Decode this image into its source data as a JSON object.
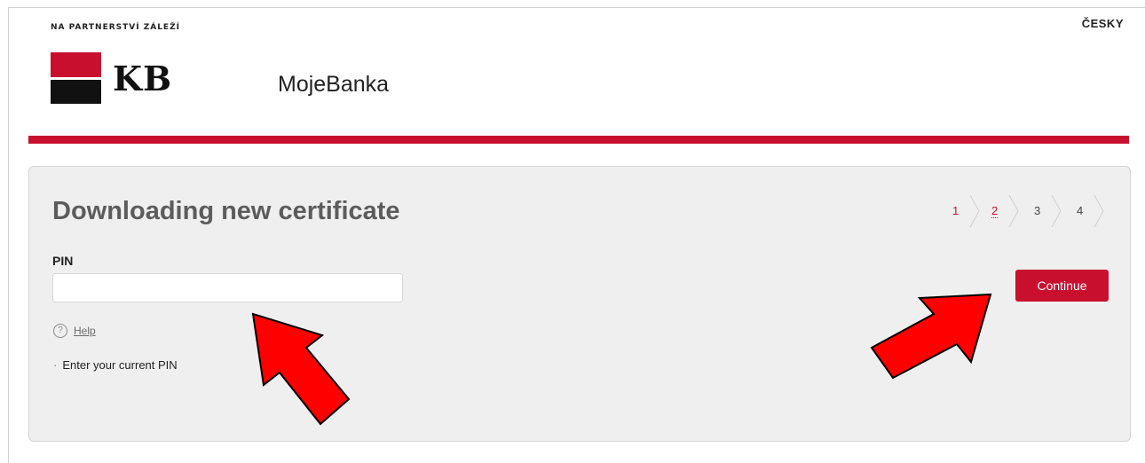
{
  "header": {
    "tagline": "NA PARTNERSTVÍ ZÁLEŽÍ",
    "language": "ČESKY",
    "logo_text": "KB",
    "app_name": "MojeBanka"
  },
  "form": {
    "title": "Downloading new certificate",
    "steps": [
      "1",
      "2",
      "3",
      "4"
    ],
    "current_step": 2,
    "pin_label": "PIN",
    "pin_value": "",
    "help_label": "Help",
    "hint": "Enter your current PIN",
    "continue_label": "Continue"
  },
  "colors": {
    "brand_red": "#c8102e",
    "panel_bg": "#efefef",
    "annotation_arrow": "#ff0000"
  },
  "annotations": {
    "arrows": [
      "red-arrow-pointing-to-pin-input",
      "red-arrow-pointing-to-continue-button"
    ]
  }
}
